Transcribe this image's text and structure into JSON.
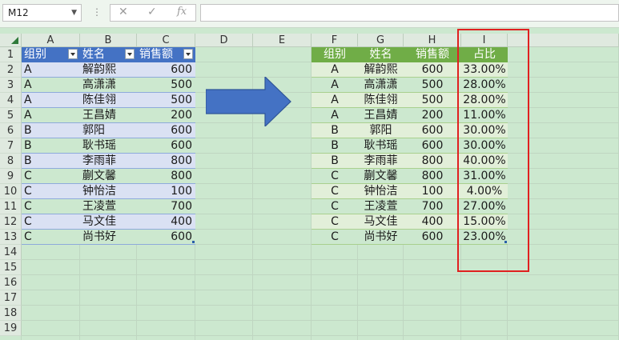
{
  "formula_bar": {
    "name_box": "M12",
    "cancel_icon": "✕",
    "confirm_icon": "✓",
    "fx_label": "fx",
    "formula_value": ""
  },
  "columns": [
    "A",
    "B",
    "C",
    "D",
    "E",
    "F",
    "G",
    "H",
    "I"
  ],
  "rows": [
    "1",
    "2",
    "3",
    "4",
    "5",
    "6",
    "7",
    "8",
    "9",
    "10",
    "11",
    "12",
    "13",
    "14",
    "15",
    "16",
    "17",
    "18",
    "19"
  ],
  "table1": {
    "headers": [
      "组别",
      "姓名",
      "销售额"
    ],
    "rows": [
      [
        "A",
        "解韵熙",
        "600"
      ],
      [
        "A",
        "高潇潇",
        "500"
      ],
      [
        "A",
        "陈佳翎",
        "500"
      ],
      [
        "A",
        "王昌婧",
        "200"
      ],
      [
        "B",
        "郭阳",
        "600"
      ],
      [
        "B",
        "耿书瑶",
        "600"
      ],
      [
        "B",
        "李雨菲",
        "800"
      ],
      [
        "C",
        "蒯文馨",
        "800"
      ],
      [
        "C",
        "钟怡洁",
        "100"
      ],
      [
        "C",
        "王凌萱",
        "700"
      ],
      [
        "C",
        "马文佳",
        "400"
      ],
      [
        "C",
        "尚书好",
        "600"
      ]
    ]
  },
  "table2": {
    "headers": [
      "组别",
      "姓名",
      "销售额",
      "占比"
    ],
    "rows": [
      [
        "A",
        "解韵熙",
        "600",
        "33.00%"
      ],
      [
        "A",
        "高潇潇",
        "500",
        "28.00%"
      ],
      [
        "A",
        "陈佳翎",
        "500",
        "28.00%"
      ],
      [
        "A",
        "王昌婧",
        "200",
        "11.00%"
      ],
      [
        "B",
        "郭阳",
        "600",
        "30.00%"
      ],
      [
        "B",
        "耿书瑶",
        "600",
        "30.00%"
      ],
      [
        "B",
        "李雨菲",
        "800",
        "40.00%"
      ],
      [
        "C",
        "蒯文馨",
        "800",
        "31.00%"
      ],
      [
        "C",
        "钟怡洁",
        "100",
        "4.00%"
      ],
      [
        "C",
        "王凌萱",
        "700",
        "27.00%"
      ],
      [
        "C",
        "马文佳",
        "400",
        "15.00%"
      ],
      [
        "C",
        "尚书好",
        "600",
        "23.00%"
      ]
    ]
  },
  "colors": {
    "table1_header": "#4472c4",
    "table1_band_a": "#dae1f3",
    "table1_band_b": "#cce8cf",
    "table2_header": "#70ad47",
    "table2_band_a": "#e2efd9",
    "table2_band_b": "#cce8cf",
    "arrow": "#4472c4",
    "highlight_box": "#e02020"
  }
}
